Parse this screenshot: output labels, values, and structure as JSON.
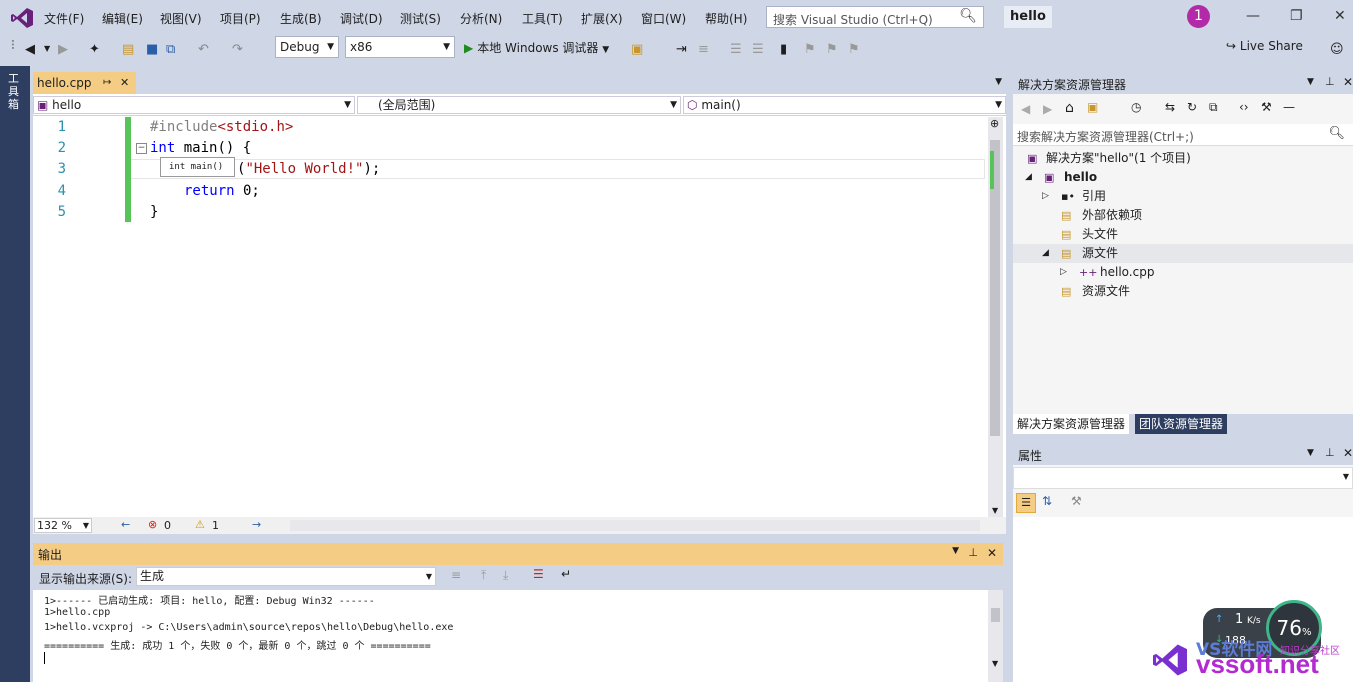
{
  "menu": [
    "文件(F)",
    "编辑(E)",
    "视图(V)",
    "项目(P)",
    "生成(B)",
    "调试(D)",
    "测试(S)",
    "分析(N)",
    "工具(T)",
    "扩展(X)",
    "窗口(W)",
    "帮助(H)"
  ],
  "search_placeholder": "搜索 Visual Studio (Ctrl+Q)",
  "solution_name": "hello",
  "notification_count": "1",
  "toolbar": {
    "config": "Debug",
    "platform": "x86",
    "run_label": "本地 Windows 调试器",
    "live_share": "Live Share"
  },
  "toolstrip_label": "工具箱",
  "editor": {
    "tab": "hello.cpp",
    "nav_project": "hello",
    "nav_scope": "(全局范围)",
    "nav_member": "main()",
    "line_numbers": [
      "1",
      "2",
      "3",
      "4",
      "5"
    ],
    "lines": {
      "l1_pp": "#include",
      "l1_hdr": "<stdio.h>",
      "l2_kw": "int",
      "l2_rest": " main() {",
      "l3_rest": "(\"Hello World!\");",
      "l3_str": "\"Hello World!\"",
      "l4_kw": "return",
      "l4_rest": " 0;",
      "l5": "}"
    },
    "tooltip": "int main()",
    "zoom": "132 %",
    "errors": "0",
    "warnings": "1"
  },
  "output": {
    "title": "输出",
    "source_label": "显示输出来源(S):",
    "source_value": "生成",
    "lines": [
      "1>------ 已启动生成: 项目: hello, 配置: Debug Win32 ------",
      "1>hello.cpp",
      "1>hello.vcxproj -> C:\\Users\\admin\\source\\repos\\hello\\Debug\\hello.exe",
      "========== 生成: 成功 1 个，失败 0 个，最新 0 个，跳过 0 个 =========="
    ]
  },
  "solution_explorer": {
    "title": "解决方案资源管理器",
    "search_placeholder": "搜索解决方案资源管理器(Ctrl+;)",
    "tree": [
      {
        "label": "解决方案\"hello\"(1 个项目)"
      },
      {
        "label": "hello"
      },
      {
        "label": "引用"
      },
      {
        "label": "外部依赖项"
      },
      {
        "label": "头文件"
      },
      {
        "label": "源文件"
      },
      {
        "label": "hello.cpp"
      },
      {
        "label": "资源文件"
      }
    ],
    "tabs": [
      "解决方案资源管理器",
      "团队资源管理器"
    ]
  },
  "properties": {
    "title": "属性"
  },
  "net_widget": {
    "speed": "1",
    "unit": "K/s",
    "down": "188",
    "percent": "76",
    "percent_unit": "%"
  },
  "watermark": {
    "brand": "VS软件网",
    "sub": "知识分享社区",
    "url": "vssoft.net"
  },
  "colors": {
    "accent": "#68217a",
    "tab_active": "#f5cc84",
    "chrome": "#cfd6e5",
    "keyword": "#0000ff",
    "string": "#a31515"
  }
}
